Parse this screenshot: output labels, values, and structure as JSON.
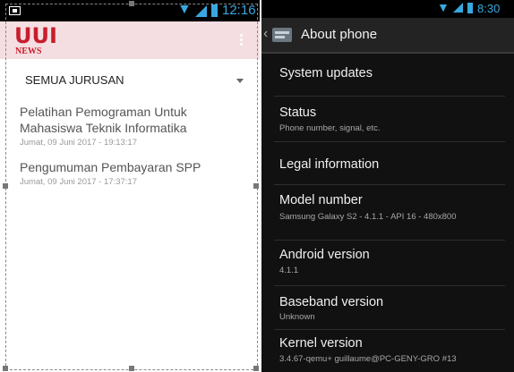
{
  "left_phone": {
    "status_bar": {
      "time": "12:16"
    },
    "app": {
      "logo_text": "UUI",
      "logo_subtext": "NEWS"
    },
    "filter": {
      "selected": "SEMUA JURUSAN"
    },
    "news": [
      {
        "title": "Pelatihan Pemograman Untuk Mahasiswa Teknik Informatika",
        "date": "Jumat, 09 Juni 2017 - 19:13:17"
      },
      {
        "title": "Pengumuman Pembayaran SPP",
        "date": "Jumat, 09 Juni 2017 - 17:37:17"
      }
    ]
  },
  "right_phone": {
    "status_bar": {
      "time": "8:30"
    },
    "title": "About phone",
    "items": [
      {
        "title": "System updates",
        "subtitle": ""
      },
      {
        "title": "Status",
        "subtitle": "Phone number, signal, etc."
      },
      {
        "title": "Legal information",
        "subtitle": ""
      },
      {
        "title": "Model number",
        "subtitle": "Samsung Galaxy S2 - 4.1.1 - API 16 - 480x800"
      },
      {
        "title": "Android version",
        "subtitle": "4.1.1"
      },
      {
        "title": "Baseband version",
        "subtitle": "Unknown"
      },
      {
        "title": "Kernel version",
        "subtitle": "3.4.67-qemu+ guillaume@PC-GENY-GRO #13"
      }
    ]
  },
  "colors": {
    "brand_red": "#c81d2d",
    "appbar_pink": "#f5dee1",
    "status_blue": "#38a8e0"
  },
  "icons": [
    "notification-icon",
    "wifi-icon",
    "signal-icon",
    "battery-icon",
    "overflow-menu-icon",
    "back-icon",
    "settings-icon",
    "dropdown-caret-icon"
  ]
}
